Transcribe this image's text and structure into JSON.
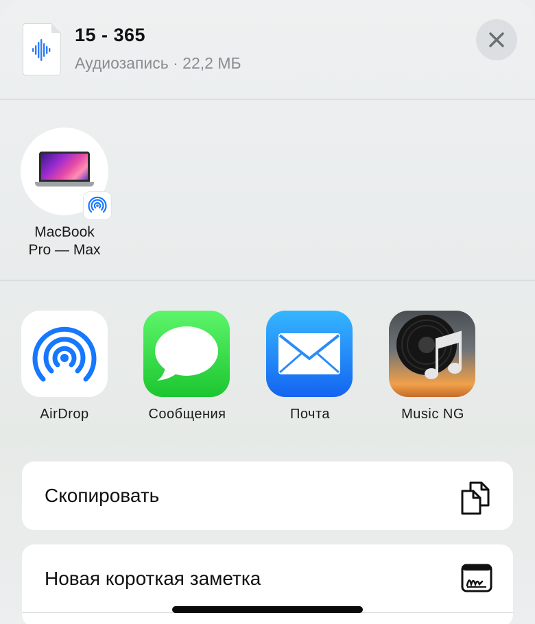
{
  "header": {
    "title": "15 - 365",
    "subtitle": "Аудиозапись · 22,2 МБ"
  },
  "device": {
    "label_line1": "MacBook",
    "label_line2": "Pro — Max"
  },
  "apps": [
    {
      "label": "AirDrop",
      "icon": "airdrop-icon"
    },
    {
      "label": "Сообщения",
      "icon": "messages-icon"
    },
    {
      "label": "Почта",
      "icon": "mail-icon"
    },
    {
      "label": "Music NG",
      "icon": "music-ng-icon"
    }
  ],
  "actions": [
    {
      "label": "Скопировать",
      "icon": "copy-icon"
    },
    {
      "label": "Новая короткая заметка",
      "icon": "quick-note-icon"
    }
  ],
  "colors": {
    "accent": "#1677ff",
    "messages_green": "#28c840",
    "mail_blue": "#1a8cff"
  }
}
